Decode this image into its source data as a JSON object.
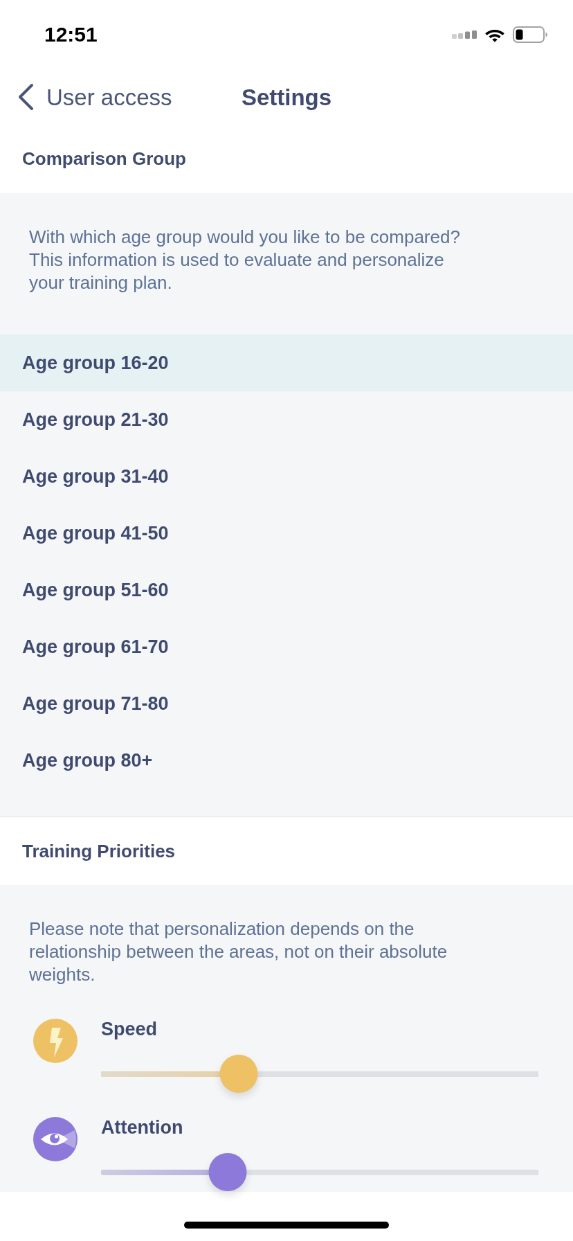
{
  "status_bar": {
    "time": "12:51"
  },
  "nav": {
    "back_label": "User access",
    "title": "Settings"
  },
  "comparison_group": {
    "title": "Comparison Group",
    "description": "With which age group would you like to be compared? This information is used to evaluate and personalize your training plan.",
    "options": [
      {
        "label": "Age group 16-20",
        "selected": true
      },
      {
        "label": "Age group 21-30",
        "selected": false
      },
      {
        "label": "Age group 31-40",
        "selected": false
      },
      {
        "label": "Age group 41-50",
        "selected": false
      },
      {
        "label": "Age group 51-60",
        "selected": false
      },
      {
        "label": "Age group 61-70",
        "selected": false
      },
      {
        "label": "Age group 71-80",
        "selected": false
      },
      {
        "label": "Age group 80+",
        "selected": false
      }
    ]
  },
  "training_priorities": {
    "title": "Training Priorities",
    "description": "Please note that personalization depends on the relationship between the areas, not on their absolute weights.",
    "items": [
      {
        "label": "Speed",
        "color": "#eec264",
        "level": 0.315
      },
      {
        "label": "Attention",
        "color": "#8c79d9",
        "level": 0.29
      }
    ]
  }
}
